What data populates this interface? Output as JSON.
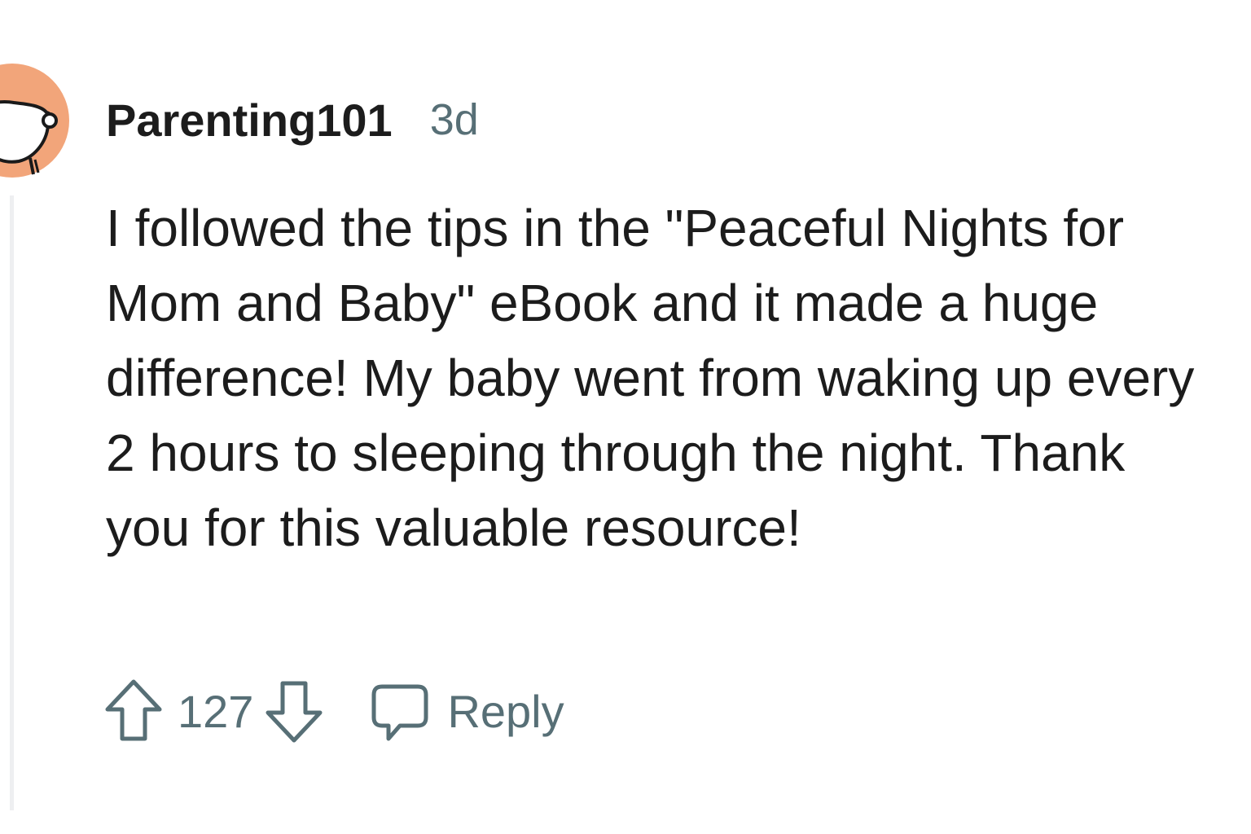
{
  "comment": {
    "username": "Parenting101",
    "timestamp": "3d",
    "body": "I followed the tips in the \"Peaceful Nights for Mom and Baby\" eBook and it made a huge difference! My baby went from waking up every 2 hours to sleeping through the night. Thank you for this valuable resource!",
    "score": "127",
    "reply_label": "Reply"
  },
  "colors": {
    "avatar_bg": "#f2a57a",
    "meta_text": "#576f76",
    "body_text": "#1c1c1c"
  },
  "icons": {
    "upvote": "arrow-up-outline-icon",
    "downvote": "arrow-down-outline-icon",
    "reply": "speech-bubble-icon",
    "avatar": "snoo-avatar-icon"
  }
}
